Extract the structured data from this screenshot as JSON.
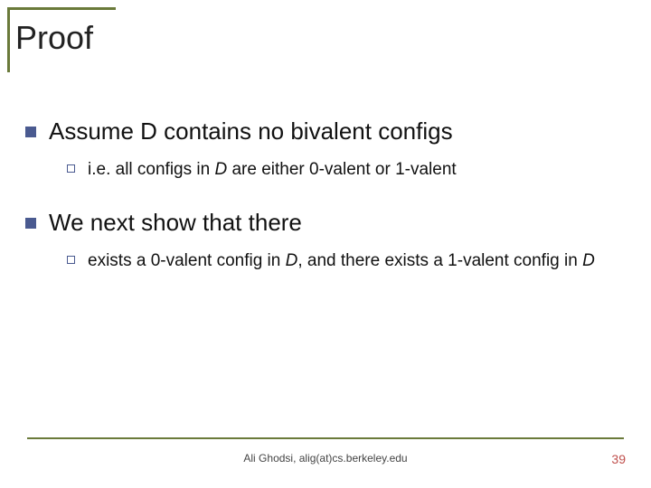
{
  "title": "Proof",
  "items": [
    {
      "text": "Assume D contains no bivalent configs",
      "sub": [
        {
          "pre": "i.e. all configs in ",
          "ital": "D",
          "post": " are either 0-valent or 1-valent"
        }
      ]
    },
    {
      "text": "We next show that there",
      "sub": [
        {
          "pre": "exists a 0-valent config in ",
          "ital": "D",
          "post": ", and there exists a 1-valent config in ",
          "ital2": "D"
        }
      ]
    }
  ],
  "footer": {
    "center": "Ali Ghodsi, alig(at)cs.berkeley.edu",
    "page": "39"
  }
}
